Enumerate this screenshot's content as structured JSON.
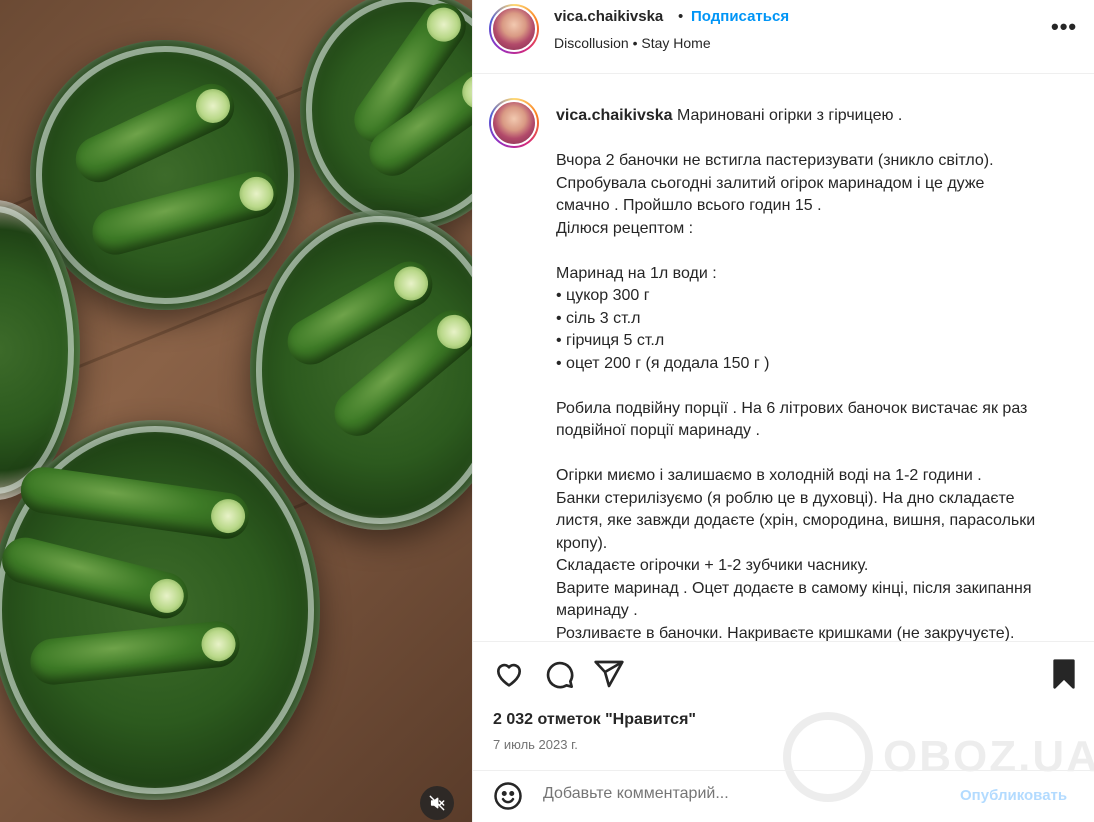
{
  "post": {
    "username": "vica.chaikivska",
    "dot": "•",
    "follow_label": "Подписаться",
    "subline": "Discollusion • Stay Home",
    "more_icon": "•••"
  },
  "caption": {
    "username": "vica.chaikivska",
    "text": " Мариновані огірки з гірчицею .\n\nВчора 2 баночки не встигла пастеризувати (зникло світло).\nСпробувала сьогодні залитий огірок маринадом і це дуже\nсмачно . Пройшло всього годин 15 .\nДілюся рецептом :\n\nМаринад на 1л води :\n• цукор 300 г\n• сіль 3 ст.л\n• гірчиця 5 ст.л\n• оцет 200 г (я додала 150 г )\n\nРобила подвійну порції . На 6 літрових баночок вистачає як раз\nподвійної порції маринаду .\n\nОгірки миємо і залишаємо в холодній воді на 1-2 години .\nБанки стерилізуємо (я роблю це в духовці). На дно складаєте\nлистя, яке завжди додаєте (хрін, смородина, вишня, парасольки\nкропу).\nСкладаєте огірочки + 1-2 зубчики часнику.\nВарите маринад . Оцет додаєте в самому кінці, після закипання\nмаринаду .\nРозливаєте в баночки. Накриваєте кришками (не закручуєте)."
  },
  "stats": {
    "likes": "2 032 отметок \"Нравится\"",
    "date": "7 июль 2023 г."
  },
  "comment": {
    "placeholder": "Добавьте комментарий...",
    "publish_label": "Опубликовать"
  },
  "watermark": {
    "text": "OBOZ.UA"
  },
  "icons": {
    "more": "more-options-icon",
    "like": "heart-icon",
    "comment": "comment-icon",
    "share": "share-icon",
    "save": "bookmark-icon",
    "emoji": "emoji-icon",
    "mute": "mute-icon"
  },
  "colors": {
    "accent": "#0095f6",
    "publish_disabled": "#b3dbff",
    "text": "#262626",
    "muted": "#737373",
    "border": "#efefef"
  }
}
